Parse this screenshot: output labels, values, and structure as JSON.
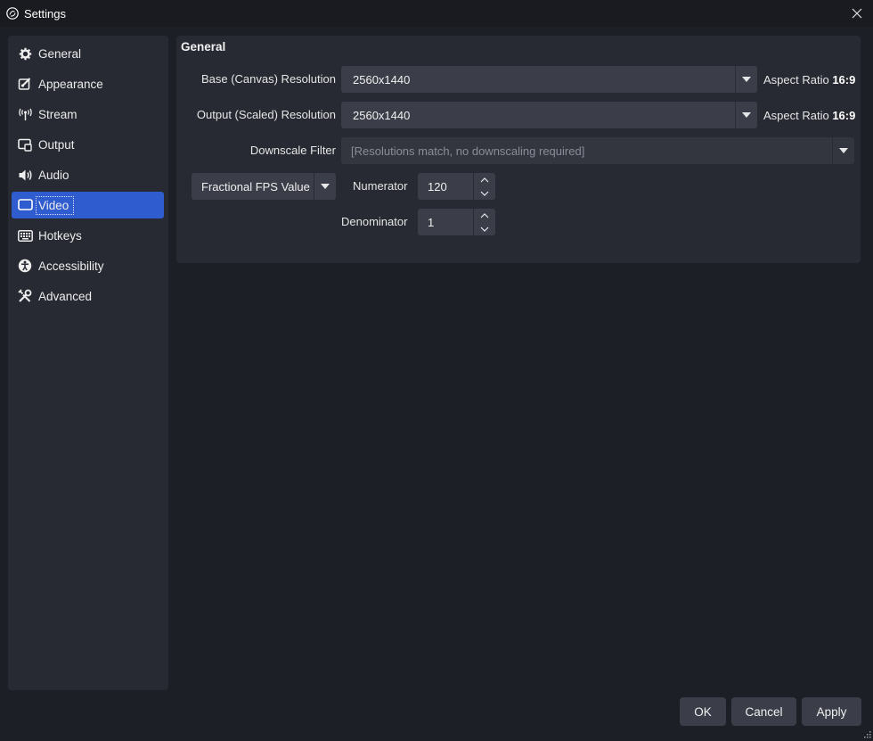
{
  "window": {
    "title": "Settings"
  },
  "sidebar": {
    "items": [
      {
        "label": "General",
        "icon": "gear-icon"
      },
      {
        "label": "Appearance",
        "icon": "appearance-icon"
      },
      {
        "label": "Stream",
        "icon": "antenna-icon"
      },
      {
        "label": "Output",
        "icon": "output-icon"
      },
      {
        "label": "Audio",
        "icon": "speaker-icon"
      },
      {
        "label": "Video",
        "icon": "monitor-icon"
      },
      {
        "label": "Hotkeys",
        "icon": "keyboard-icon"
      },
      {
        "label": "Accessibility",
        "icon": "accessibility-icon"
      },
      {
        "label": "Advanced",
        "icon": "tools-icon"
      }
    ],
    "active": "Video"
  },
  "general": {
    "title": "General",
    "base_label": "Base (Canvas) Resolution",
    "base_value": "2560x1440",
    "base_aspect_prefix": "Aspect Ratio",
    "base_aspect_value": "16:9",
    "output_label": "Output (Scaled) Resolution",
    "output_value": "2560x1440",
    "output_aspect_prefix": "Aspect Ratio",
    "output_aspect_value": "16:9",
    "downscale_label": "Downscale Filter",
    "downscale_value": "[Resolutions match, no downscaling required]",
    "fps_type": "Fractional FPS Value",
    "numerator_label": "Numerator",
    "numerator_value": "120",
    "denominator_label": "Denominator",
    "denominator_value": "1"
  },
  "buttons": {
    "ok": "OK",
    "cancel": "Cancel",
    "apply": "Apply"
  },
  "colors": {
    "background": "#1d1f26",
    "panel": "#282a33",
    "field": "#3b3e49",
    "accent": "#2f5ccf"
  }
}
